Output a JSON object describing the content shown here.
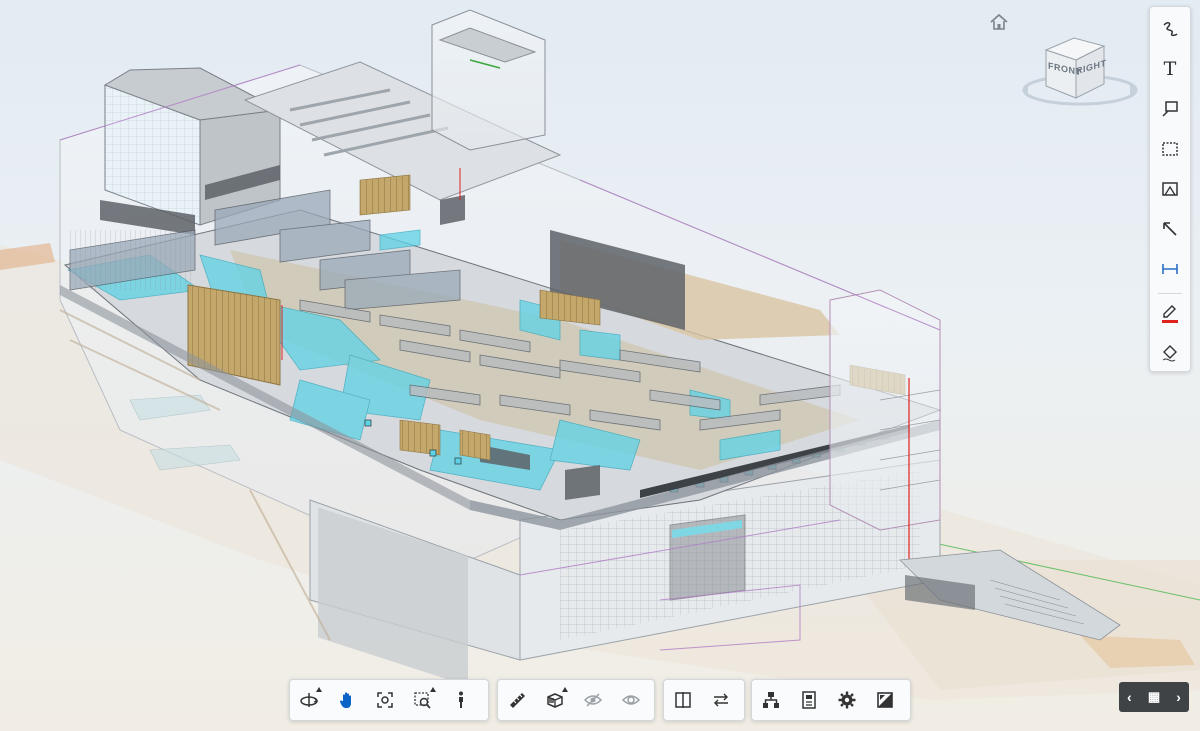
{
  "app": {
    "view": "3d-model-viewer"
  },
  "colors": {
    "accent": "#0a64c6",
    "glass_cyan": "#5fd3e6",
    "wood": "#b89a5a",
    "toolbar_bg": "#fafbfc",
    "pager_bg": "#3f4346",
    "markup_red": "#e0221f"
  },
  "viewcube": {
    "front_label": "FRONT",
    "right_label": "RIGHT"
  },
  "right_toolbar": {
    "tools": [
      {
        "name": "freehand-icon"
      },
      {
        "name": "text-icon"
      },
      {
        "name": "callout-icon"
      },
      {
        "name": "rectangle-icon"
      },
      {
        "name": "cloud-icon"
      },
      {
        "name": "arrow-icon"
      },
      {
        "name": "dimension-icon"
      },
      {
        "name": "pen-color-icon",
        "color": "#e0221f"
      },
      {
        "name": "fill-icon"
      }
    ],
    "text_glyph": "T"
  },
  "bottom_toolbar": {
    "groups": [
      [
        "orbit-icon",
        "pan-icon",
        "fit-view-icon",
        "zoom-window-icon",
        "walk-icon"
      ],
      [
        "measure-icon",
        "section-box-icon",
        "hide-icon",
        "isolate-icon"
      ],
      [
        "split-view-icon",
        "sync-icon"
      ],
      [
        "model-tree-icon",
        "properties-icon",
        "settings-icon",
        "fullscreen-icon"
      ]
    ],
    "active_tool": "pan-icon"
  },
  "pager": {
    "prev": "‹",
    "grid": "▦",
    "next": "›"
  }
}
